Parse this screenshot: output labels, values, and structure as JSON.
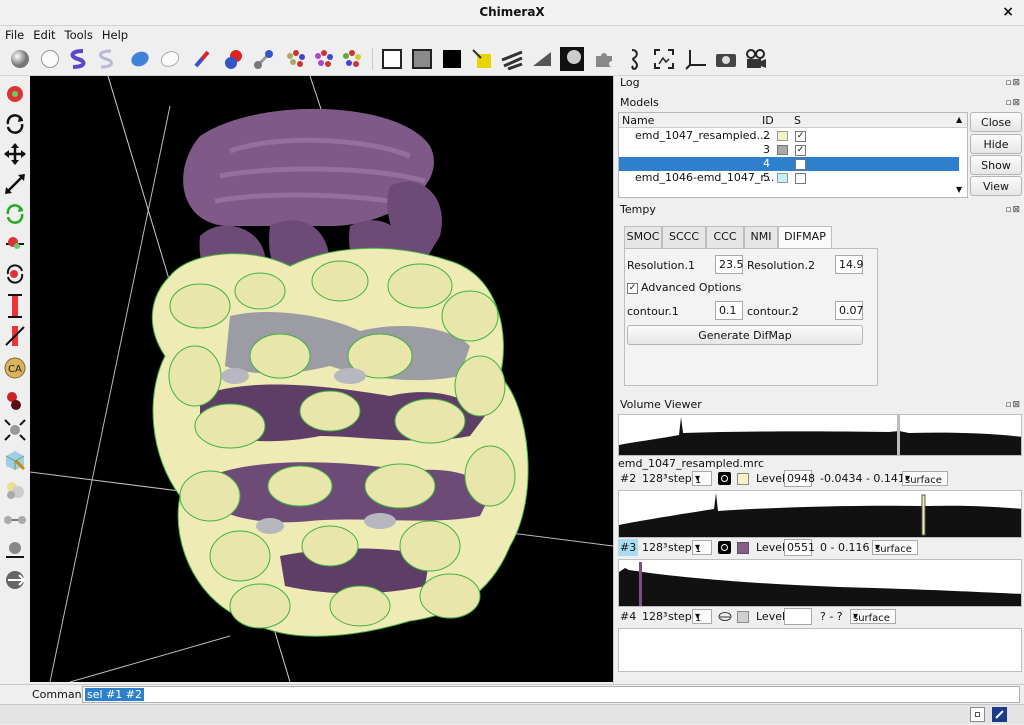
{
  "window": {
    "title": "ChimeraX",
    "close_glyph": "×"
  },
  "menu": [
    "File",
    "Edit",
    "Tools",
    "Help"
  ],
  "log": {
    "title": "Log"
  },
  "models": {
    "title": "Models",
    "columns": [
      "Name",
      "ID",
      "S"
    ],
    "rows": [
      {
        "name": "emd_1047_resampled....",
        "id": "2",
        "color": "#f5f3c6",
        "shown": true,
        "selected": false
      },
      {
        "name": "",
        "id": "3",
        "color": "#a8a8a8",
        "shown": true,
        "selected": false
      },
      {
        "name": "",
        "id": "4",
        "color": "",
        "shown": false,
        "selected": true
      },
      {
        "name": "emd_1046-emd_1047_r...",
        "id": "5",
        "color": "#c4f1f5",
        "shown": false,
        "selected": false
      }
    ],
    "buttons": [
      "Close",
      "Hide",
      "Show",
      "View"
    ]
  },
  "tempy": {
    "title": "Tempy",
    "tabs": [
      "SMOC",
      "SCCC",
      "CCC",
      "NMI",
      "DIFMAP"
    ],
    "active_tab": "DIFMAP",
    "resolution1_label": "Resolution.1",
    "resolution1": "23.5",
    "resolution2_label": "Resolution.2",
    "resolution2": "14.9",
    "advanced_label": "Advanced Options",
    "advanced_checked": true,
    "contour1_label": "contour.1",
    "contour1": "0.1",
    "contour2_label": "contour.2",
    "contour2": "0.07",
    "generate_label": "Generate DifMap"
  },
  "volume_viewer": {
    "title": "Volume Viewer",
    "map_name": "emd_1047_resampled.mrc",
    "rows": [
      {
        "id": "#2",
        "size": "128³",
        "step_label": "step",
        "step": "1",
        "color": "#f5f3c6",
        "level_label": "Level",
        "level": "0948",
        "range": "-0.0434 - 0.141",
        "style": "surface"
      },
      {
        "id": "#3",
        "size": "128³",
        "step_label": "step",
        "step": "1",
        "color": "#8a5c8a",
        "level_label": "Level",
        "level": "0551",
        "range": "0 - 0.116",
        "style": "surface"
      },
      {
        "id": "#4",
        "size": "128³",
        "step_label": "step",
        "step": "1",
        "color": "#d0d0d0",
        "level_label": "Level",
        "level": "",
        "range": "? - ?",
        "style": "surface"
      }
    ]
  },
  "command": {
    "label": "Command:",
    "value": "sel #1 #2"
  },
  "icons": {
    "toolbar": [
      "sphere-icon",
      "ball-outline-icon",
      "ribbon-icon",
      "ribbon-outline-icon",
      "surface-blob-icon",
      "surface-outline-icon",
      "stick-icon",
      "ball-stick-icon",
      "atom-stick-icon",
      "molecule-icon",
      "molecule-colored-icon",
      "molecule-hetero-icon",
      "white-background-icon",
      "gray-background-icon",
      "black-background-icon",
      "light-simple-icon",
      "light-full-icon",
      "light-flat-icon",
      "silhouette-icon",
      "puzzle-icon",
      "seahorse-icon",
      "snapshot-icon",
      "axes-icon",
      "camera-icon",
      "movie-camera-icon"
    ],
    "left": [
      "select-icon",
      "rotate-icon",
      "translate-icon",
      "zoom-icon",
      "rotate-selected-icon",
      "move-atoms-icon",
      "swapaa-icon",
      "distance-icon",
      "delete-bond-icon",
      "ca-label-icon",
      "pick-blob-icon",
      "resize-icon",
      "map-icon",
      "tug-icon",
      "bond-icon",
      "rotamer-icon",
      "play-icon"
    ]
  }
}
